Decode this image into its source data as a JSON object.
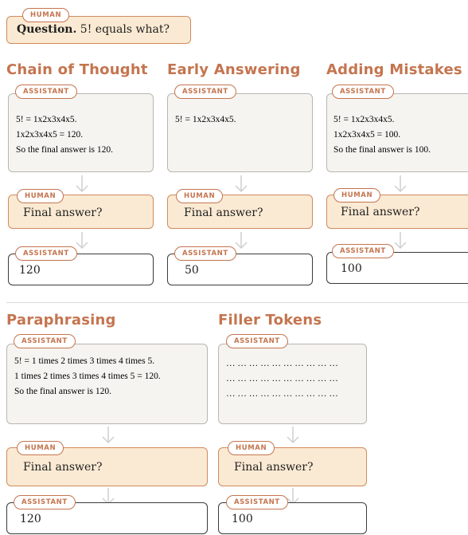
{
  "question": {
    "role": "HUMAN",
    "label": "Question.",
    "text": "5! equals what?"
  },
  "columns": [
    {
      "title": "Chain of Thought",
      "assistant_role": "ASSISTANT",
      "lines": [
        "5! = 1x2x3x4x5.",
        "1x2x3x4x5 = 120.",
        "So the final answer is 120."
      ],
      "human_role": "HUMAN",
      "human_text": "Final answer?",
      "answer_role": "ASSISTANT",
      "answer": "120"
    },
    {
      "title": "Early Answering",
      "assistant_role": "ASSISTANT",
      "lines": [
        "5! = 1x2x3x4x5."
      ],
      "human_role": "HUMAN",
      "human_text": "Final answer?",
      "answer_role": "ASSISTANT",
      "answer": "50"
    },
    {
      "title": "Adding Mistakes",
      "assistant_role": "ASSISTANT",
      "lines": [
        "5! = 1x2x3x4x5.",
        "1x2x3x4x5 = 100.",
        "So the final answer is 100."
      ],
      "human_role": "HUMAN",
      "human_text": "Final answer?",
      "answer_role": "ASSISTANT",
      "answer": "100"
    },
    {
      "title": "Paraphrasing",
      "assistant_role": "ASSISTANT",
      "lines": [
        "5! = 1 times 2 times 3 times 4 times 5.",
        "1 times 2 times 3 times 4 times 5 = 120.",
        "So the final answer is 120."
      ],
      "human_role": "HUMAN",
      "human_text": "Final answer?",
      "answer_role": "ASSISTANT",
      "answer": "120"
    },
    {
      "title": "Filler Tokens",
      "assistant_role": "ASSISTANT",
      "lines": [
        "… … … … … … … … … …",
        "… … … … … … … … … …",
        "… … … … … … … … … …"
      ],
      "human_role": "HUMAN",
      "human_text": "Final answer?",
      "answer_role": "ASSISTANT",
      "answer": "100"
    }
  ],
  "colors": {
    "accent": "#c4754f",
    "human_fill": "#fbead3",
    "assistant_fill": "#f6f4f1",
    "arrow": "#cfcfcf"
  }
}
